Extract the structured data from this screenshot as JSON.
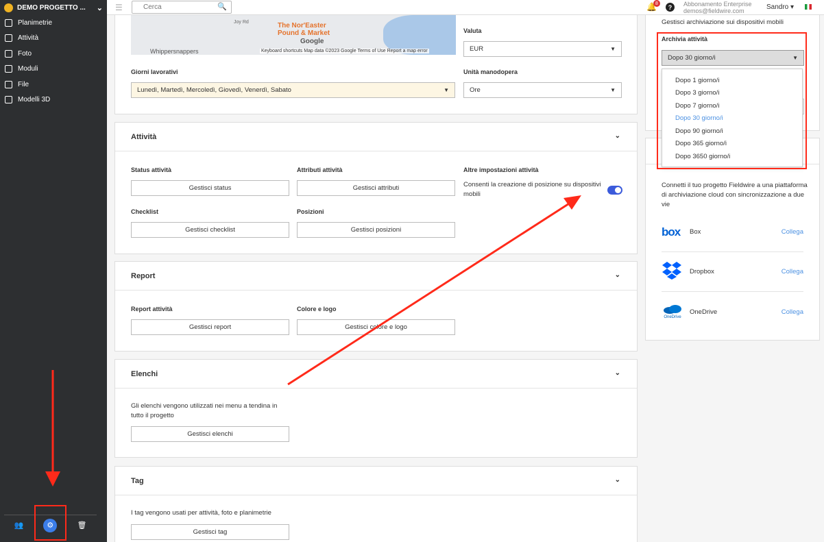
{
  "project": {
    "name": "DEMO PROGETTO ..."
  },
  "sidebar": {
    "items": [
      {
        "label": "Planimetrie",
        "icon": "floorplan-icon"
      },
      {
        "label": "Attività",
        "icon": "tasks-icon"
      },
      {
        "label": "Foto",
        "icon": "camera-icon"
      },
      {
        "label": "Moduli",
        "icon": "forms-icon"
      },
      {
        "label": "File",
        "icon": "paperclip-icon"
      },
      {
        "label": "Modelli 3D",
        "icon": "cube-icon"
      }
    ]
  },
  "topbar": {
    "search_placeholder": "Cerca",
    "notifications": "8",
    "plan": "Abbonamento Enterprise",
    "email": "demos@fieldwire.com",
    "user": "Sandro"
  },
  "map": {
    "road": "Joy Rd",
    "poi": "The Nor'Easter\nPound & Market",
    "poi2": "Whippersnappers",
    "brand": "Google",
    "attribution": "Keyboard shortcuts   Map data ©2023 Google   Terms of Use   Report a map error"
  },
  "general": {
    "valuta_label": "Valuta",
    "valuta_value": "EUR",
    "giorni_label": "Giorni lavorativi",
    "giorni_value": "Lunedì, Martedì, Mercoledì, Giovedì, Venerdì, Sabato",
    "unita_label": "Unità manodopera",
    "unita_value": "Ore"
  },
  "attivita": {
    "title": "Attività",
    "status_label": "Status attività",
    "status_btn": "Gestisci status",
    "attributi_label": "Attributi attività",
    "attributi_btn": "Gestisci attributi",
    "altre_label": "Altre impostazioni attività",
    "altre_text": "Consenti la creazione di posizione su dispositivi mobili",
    "checklist_label": "Checklist",
    "checklist_btn": "Gestisci checklist",
    "posizioni_label": "Posizioni",
    "posizioni_btn": "Gestisci posizioni"
  },
  "report": {
    "title": "Report",
    "report_label": "Report attività",
    "report_btn": "Gestisci report",
    "colore_label": "Colore e logo",
    "colore_btn": "Gestisci colore e logo"
  },
  "elenchi": {
    "title": "Elenchi",
    "text": "Gli elenchi vengono utilizzati nei menu a tendina in tutto il progetto",
    "btn": "Gestisci elenchi"
  },
  "tag": {
    "title": "Tag",
    "text": "I tag vengono usati per attività, foto e planimetrie",
    "btn": "Gestisci tag"
  },
  "archive": {
    "subtitle": "Gestisci archiviazione sui dispositivi mobili",
    "label": "Archivia attività",
    "value": "Dopo 30 giorno/i",
    "options": [
      "Dopo 1 giorno/i",
      "Dopo 3 giorno/i",
      "Dopo 7 giorno/i",
      "Dopo 30 giorno/i",
      "Dopo 90 giorno/i",
      "Dopo 365 giorno/i",
      "Dopo 3650 giorno/i"
    ],
    "selected_index": 3
  },
  "cloud": {
    "text": "Connetti il tuo progetto Fieldwire a una piattaforma di archiviazione cloud con sincronizzazione a due vie",
    "services": [
      {
        "name": "Box",
        "link": "Collega",
        "logo": "box"
      },
      {
        "name": "Dropbox",
        "link": "Collega"
      },
      {
        "name": "OneDrive",
        "link": "Collega",
        "logo": "OneDrive"
      }
    ]
  },
  "colors": {
    "accent": "#4a90e2",
    "annotation": "#ff2a1a",
    "sidebar": "#2d2f31",
    "toggle": "#3b5bdb"
  }
}
